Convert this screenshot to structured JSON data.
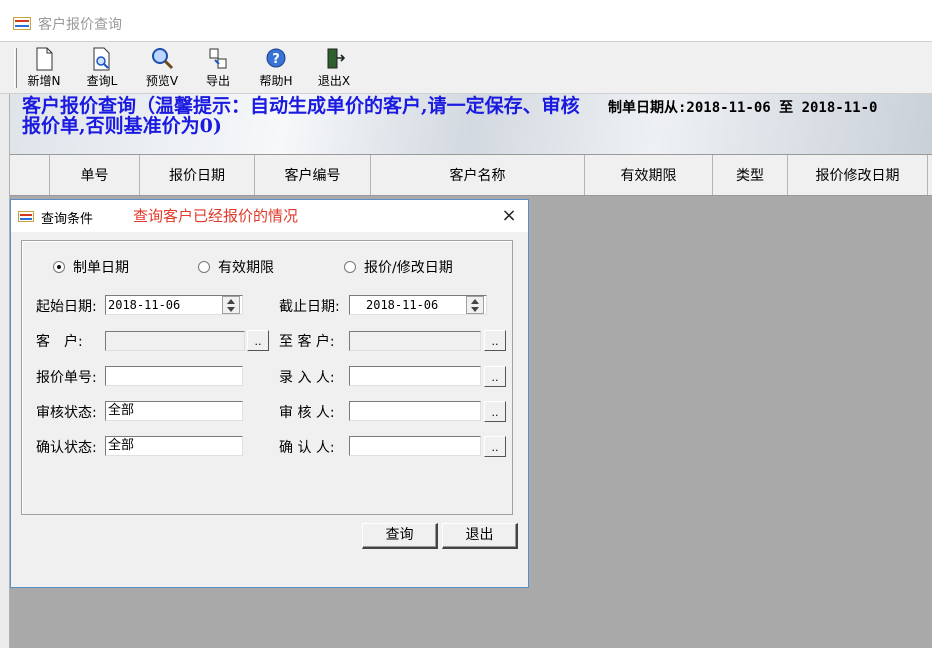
{
  "window": {
    "title": "客户报价查询"
  },
  "toolbar": {
    "items": [
      {
        "label": "新增N",
        "icon": "new-document-icon"
      },
      {
        "label": "查询L",
        "icon": "search-document-icon"
      },
      {
        "label": "预览V",
        "icon": "magnifier-icon"
      },
      {
        "label": "导出",
        "icon": "export-icon"
      },
      {
        "label": "帮助H",
        "icon": "help-icon"
      },
      {
        "label": "退出X",
        "icon": "exit-door-icon"
      }
    ]
  },
  "banner": {
    "title": "客户报价查询（温馨提示：自动生成单价的客户,请一定保存、审核报价单,否则基准价为0)",
    "date_range": "制单日期从:2018-11-06 至 2018-11-0"
  },
  "grid": {
    "columns": [
      "",
      "单号",
      "报价日期",
      "客户编号",
      "客户名称",
      "有效期限",
      "类型",
      "报价修改日期"
    ]
  },
  "dialog": {
    "title": "查询条件",
    "hint": "查询客户已经报价的情况",
    "close": "×",
    "radios": [
      {
        "label": "制单日期",
        "checked": true
      },
      {
        "label": "有效期限",
        "checked": false
      },
      {
        "label": "报价/修改日期",
        "checked": false
      }
    ],
    "start_date_label": "起始日期:",
    "start_date": "2018-11-06",
    "end_date_label": "截止日期:",
    "end_date": "2018-11-06",
    "customer_label": "客　户:",
    "customer_value": "",
    "to_customer_label": "至 客 户:",
    "to_customer_value": "",
    "quote_no_label": "报价单号:",
    "quote_no_value": "",
    "entry_person_label": "录 入 人:",
    "entry_person_value": "",
    "audit_status_label": "审核状态:",
    "audit_status_value": "全部",
    "auditor_label": "审 核 人:",
    "auditor_value": "",
    "confirm_status_label": "确认状态:",
    "confirm_status_value": "全部",
    "confirmer_label": "确 认 人:",
    "confirmer_value": "",
    "browse_label": "..",
    "query_button": "查询",
    "exit_button": "退出"
  }
}
